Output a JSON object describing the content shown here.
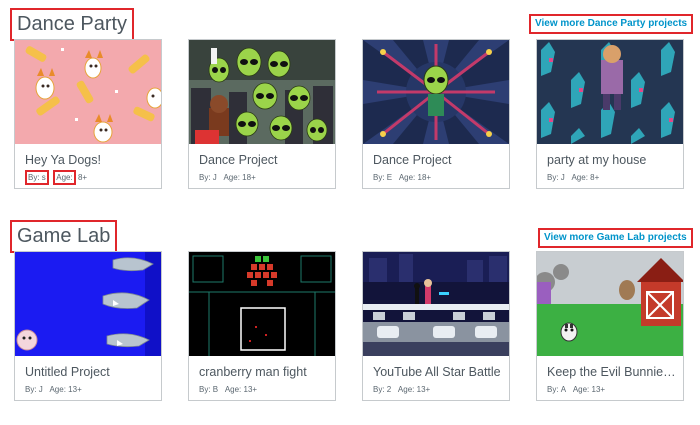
{
  "sections": [
    {
      "title": "Dance Party",
      "more_label": "View more Dance Party projects",
      "cards": [
        {
          "title": "Hey Ya Dogs!",
          "by_label": "By:",
          "author": "s",
          "age_label": "Age:",
          "age": "8+"
        },
        {
          "title": "Dance Project",
          "by_label": "By:",
          "author": "J",
          "age_label": "Age:",
          "age": "18+"
        },
        {
          "title": "Dance Project",
          "by_label": "By:",
          "author": "E",
          "age_label": "Age:",
          "age": "18+"
        },
        {
          "title": "party at my house",
          "by_label": "By:",
          "author": "J",
          "age_label": "Age:",
          "age": "8+"
        }
      ]
    },
    {
      "title": "Game Lab",
      "more_label": "View more Game Lab projects",
      "cards": [
        {
          "title": "Untitled Project",
          "by_label": "By:",
          "author": "J",
          "age_label": "Age:",
          "age": "13+"
        },
        {
          "title": "cranberry man fight",
          "by_label": "By:",
          "author": "B",
          "age_label": "Age:",
          "age": "13+"
        },
        {
          "title": "YouTube All Star Battle",
          "by_label": "By:",
          "author": "2",
          "age_label": "Age:",
          "age": "13+"
        },
        {
          "title": "Keep the Evil Bunnies Out",
          "by_label": "By:",
          "author": "A",
          "age_label": "Age:",
          "age": "13+"
        }
      ]
    }
  ],
  "colors": {
    "annotation_red": "#e0262b",
    "link_blue": "#0094ca",
    "text_gray": "#4d575f",
    "card_border": "#c6cacd"
  }
}
